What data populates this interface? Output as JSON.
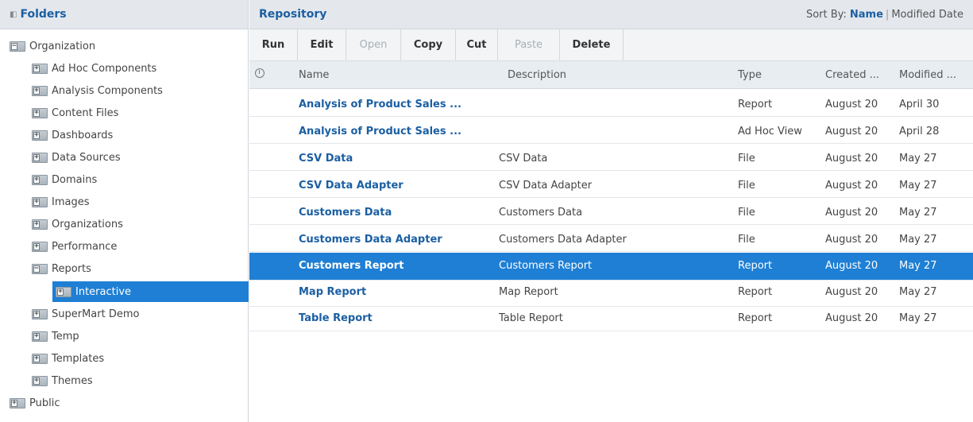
{
  "folders": {
    "title": "Folders",
    "root": "Organization",
    "items": [
      {
        "label": "Ad Hoc Components"
      },
      {
        "label": "Analysis Components"
      },
      {
        "label": "Content Files"
      },
      {
        "label": "Dashboards"
      },
      {
        "label": "Data Sources"
      },
      {
        "label": "Domains"
      },
      {
        "label": "Images"
      },
      {
        "label": "Organizations"
      },
      {
        "label": "Performance"
      },
      {
        "label": "Reports"
      },
      {
        "label": "Interactive"
      },
      {
        "label": "SuperMart Demo"
      },
      {
        "label": "Temp"
      },
      {
        "label": "Templates"
      },
      {
        "label": "Themes"
      }
    ],
    "public": "Public",
    "expanded_glyph": "−",
    "collapsed_glyph": "+"
  },
  "repository": {
    "title": "Repository",
    "sort_by_label": "Sort By:",
    "sort_name": "Name",
    "sort_modified": "Modified Date"
  },
  "toolbar": {
    "run": "Run",
    "edit": "Edit",
    "open": "Open",
    "copy": "Copy",
    "cut": "Cut",
    "paste": "Paste",
    "delete": "Delete"
  },
  "columns": {
    "name": "Name",
    "description": "Description",
    "type": "Type",
    "created": "Created ...",
    "modified": "Modified ..."
  },
  "rows": [
    {
      "name": "Analysis of Product Sales ...",
      "description": "",
      "type": "Report",
      "created": "August 20",
      "modified": "April 30"
    },
    {
      "name": "Analysis of Product Sales ...",
      "description": "",
      "type": "Ad Hoc View",
      "created": "August 20",
      "modified": "April 28"
    },
    {
      "name": "CSV Data",
      "description": "CSV Data",
      "type": "File",
      "created": "August 20",
      "modified": "May 27"
    },
    {
      "name": "CSV Data Adapter",
      "description": "CSV Data Adapter",
      "type": "File",
      "created": "August 20",
      "modified": "May 27"
    },
    {
      "name": "Customers Data",
      "description": "Customers Data",
      "type": "File",
      "created": "August 20",
      "modified": "May 27"
    },
    {
      "name": "Customers Data Adapter",
      "description": "Customers Data Adapter",
      "type": "File",
      "created": "August 20",
      "modified": "May 27"
    },
    {
      "name": "Customers Report",
      "description": "Customers Report",
      "type": "Report",
      "created": "August 20",
      "modified": "May 27"
    },
    {
      "name": "Map Report",
      "description": "Map Report",
      "type": "Report",
      "created": "August 20",
      "modified": "May 27"
    },
    {
      "name": "Table Report",
      "description": "Table Report",
      "type": "Report",
      "created": "August 20",
      "modified": "May 27"
    }
  ],
  "colors": {
    "accent": "#1b5fa3",
    "selection": "#1e7fd4"
  }
}
